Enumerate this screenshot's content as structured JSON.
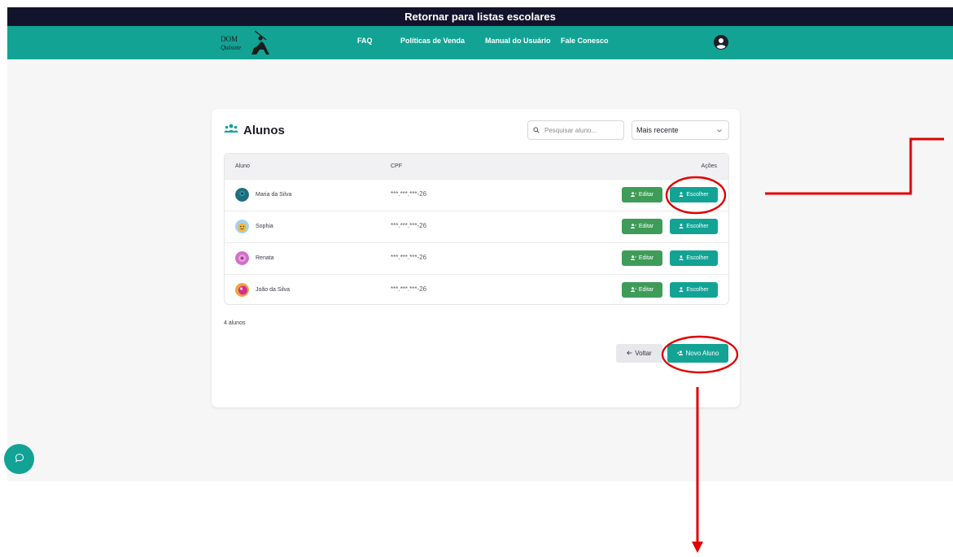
{
  "topbar": {
    "label": "Retornar para listas escolares"
  },
  "navbar": {
    "logo_alt": "Dom Quixote",
    "items": [
      {
        "label": "FAQ"
      },
      {
        "label": "Políticas de Venda"
      },
      {
        "label": "Manual do Usuário"
      },
      {
        "label": "Fale Conesco"
      }
    ]
  },
  "card": {
    "title": "Alunos",
    "search_placeholder": "Pesquisar aluno...",
    "sort_value": "Mais recente",
    "columns": {
      "aluno": "Aluno",
      "cpf": "CPF",
      "acoes": "Ações"
    },
    "students": [
      {
        "name": "Maria da Silva",
        "cpf": "***.***.***-26",
        "edit_label": "Editar",
        "choose_label": "Escolher"
      },
      {
        "name": "Sophia",
        "cpf": "***.***.***-26",
        "edit_label": "Editar",
        "choose_label": "Escolher"
      },
      {
        "name": "Renata",
        "cpf": "***.***.***-26",
        "edit_label": "Editar",
        "choose_label": "Escolher"
      },
      {
        "name": "João da Silva",
        "cpf": "***.***.***-26",
        "edit_label": "Editar",
        "choose_label": "Escolher"
      }
    ],
    "count_label": "4 alunos",
    "back_label": "Voltar",
    "new_label": "Novo Aluno"
  },
  "colors": {
    "topbar": "#11142a",
    "brand": "#12a395",
    "edit_button": "#3e9c58",
    "annotation": "#e00000"
  },
  "icons": [
    "user-circle-icon",
    "users-icon",
    "search-icon",
    "chevron-down-icon",
    "user-edit-icon",
    "user-icon",
    "arrow-left-icon",
    "user-plus-icon",
    "chat-icon"
  ]
}
